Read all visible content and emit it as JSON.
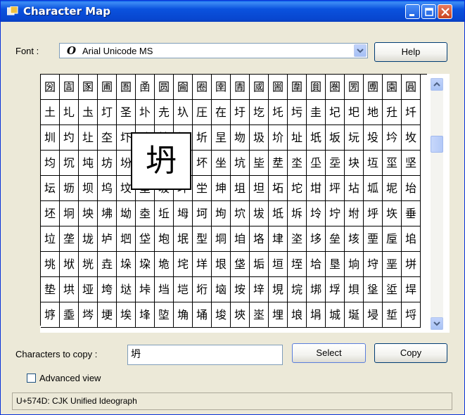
{
  "window": {
    "title": "Character Map",
    "controls": [
      "minimize",
      "maximize",
      "close"
    ]
  },
  "font_row": {
    "label": "Font :",
    "font_icon_glyph": "O",
    "selected_font": "Arial Unicode MS",
    "help_button": "Help"
  },
  "grid": {
    "rows": [
      [
        "圀",
        "圁",
        "圂",
        "圃",
        "圄",
        "圅",
        "圆",
        "圇",
        "圈",
        "圉",
        "圊",
        "國",
        "圌",
        "圍",
        "圎",
        "圏",
        "圐",
        "圑",
        "園",
        "圓"
      ],
      [
        "土",
        "圠",
        "圡",
        "圢",
        "圣",
        "圤",
        "圥",
        "圦",
        "圧",
        "在",
        "圩",
        "圪",
        "圫",
        "圬",
        "圭",
        "圮",
        "圯",
        "地",
        "圱",
        "圲"
      ],
      [
        "圳",
        "圴",
        "圵",
        "圶",
        "圷",
        "圸",
        "圹",
        "场",
        "圻",
        "圼",
        "圽",
        "圾",
        "圿",
        "址",
        "坁",
        "坂",
        "坃",
        "坄",
        "坅",
        "坆"
      ],
      [
        "均",
        "坈",
        "坉",
        "坊",
        "坋",
        "坌",
        "坍",
        "坎",
        "坏",
        "坐",
        "坑",
        "坒",
        "坓",
        "坔",
        "坕",
        "坖",
        "块",
        "坘",
        "坙",
        "坚"
      ],
      [
        "坛",
        "坜",
        "坝",
        "坞",
        "坟",
        "坠",
        "坡",
        "坢",
        "坣",
        "坤",
        "坥",
        "坦",
        "坧",
        "坨",
        "坩",
        "坪",
        "坫",
        "坬",
        "坭",
        "坮"
      ],
      [
        "坯",
        "坰",
        "坱",
        "坲",
        "坳",
        "坴",
        "坵",
        "坶",
        "坷",
        "坸",
        "坹",
        "坺",
        "坻",
        "坼",
        "坽",
        "坾",
        "坿",
        "垀",
        "垁",
        "垂"
      ],
      [
        "垃",
        "垄",
        "垅",
        "垆",
        "垇",
        "垈",
        "垉",
        "垊",
        "型",
        "垌",
        "垍",
        "垎",
        "垏",
        "垐",
        "垑",
        "垒",
        "垓",
        "垔",
        "垕",
        "垖"
      ],
      [
        "垗",
        "垘",
        "垙",
        "垚",
        "垛",
        "垜",
        "垝",
        "垞",
        "垟",
        "垠",
        "垡",
        "垢",
        "垣",
        "垤",
        "垥",
        "垦",
        "垧",
        "垨",
        "垩",
        "垪"
      ],
      [
        "垫",
        "垬",
        "垭",
        "垮",
        "垯",
        "垰",
        "垱",
        "垲",
        "垳",
        "垴",
        "垵",
        "垶",
        "垷",
        "垸",
        "垹",
        "垺",
        "垻",
        "垼",
        "垽",
        "垾"
      ],
      [
        "垿",
        "埀",
        "埁",
        "埂",
        "埃",
        "埄",
        "埅",
        "埆",
        "埇",
        "埈",
        "埉",
        "埊",
        "埋",
        "埌",
        "埍",
        "城",
        "埏",
        "埐",
        "埑",
        "埒"
      ]
    ],
    "magnified_char": "坍"
  },
  "copy_row": {
    "label": "Characters to copy :",
    "value": "坍",
    "select_button": "Select",
    "copy_button": "Copy"
  },
  "advanced_view": {
    "label": "Advanced view",
    "checked": false
  },
  "status": "U+574D: CJK Unified Ideograph",
  "colors": {
    "titlebar": "#0a52de",
    "window_bg": "#ece9d8",
    "close_button": "#c8421f"
  }
}
